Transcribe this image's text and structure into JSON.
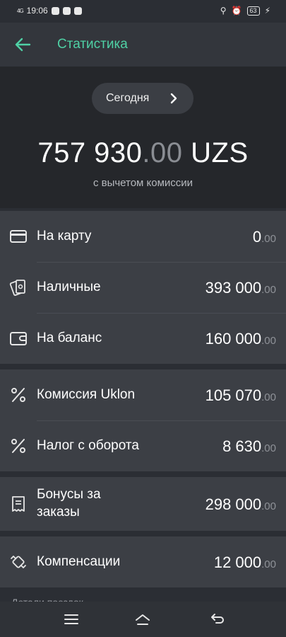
{
  "status": {
    "network": "4G",
    "time": "19:06",
    "battery": "63"
  },
  "appbar": {
    "title": "Статистика"
  },
  "hero": {
    "period": "Сегодня",
    "total_main": "757 930",
    "total_dec": ".00",
    "currency": "UZS",
    "note": "с вычетом комиссии"
  },
  "payments": [
    {
      "label": "На карту",
      "main": "0",
      "cents": ".00",
      "icon": "card-icon"
    },
    {
      "label": "Наличные",
      "main": "393 000",
      "cents": ".00",
      "icon": "cash-icon"
    },
    {
      "label": "На баланс",
      "main": "160 000",
      "cents": ".00",
      "icon": "wallet-icon"
    }
  ],
  "fees": [
    {
      "label": "Комиссия Uklon",
      "main": "105 070",
      "cents": ".00",
      "icon": "percent-icon"
    },
    {
      "label": "Налог с оборота",
      "main": "8 630",
      "cents": ".00",
      "icon": "percent-icon"
    }
  ],
  "bonus": {
    "label": "Бонусы за заказы",
    "main": "298 000",
    "cents": ".00",
    "icon": "receipt-icon"
  },
  "compensation": {
    "label": "Компенсации",
    "main": "12 000",
    "cents": ".00",
    "icon": "compensation-icon"
  },
  "details_label": "Детали поездок"
}
